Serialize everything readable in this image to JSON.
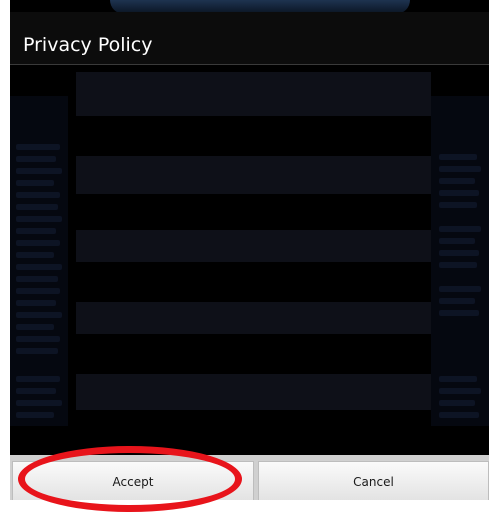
{
  "dialog": {
    "title": "Privacy Policy",
    "sections": [
      {
        "heading": ""
      },
      {
        "heading": ""
      },
      {
        "heading": ""
      },
      {
        "heading": ""
      }
    ]
  },
  "buttons": {
    "accept_label": "Accept",
    "cancel_label": "Cancel"
  },
  "annotation": {
    "color": "#e8141b",
    "target": "accept-button"
  }
}
